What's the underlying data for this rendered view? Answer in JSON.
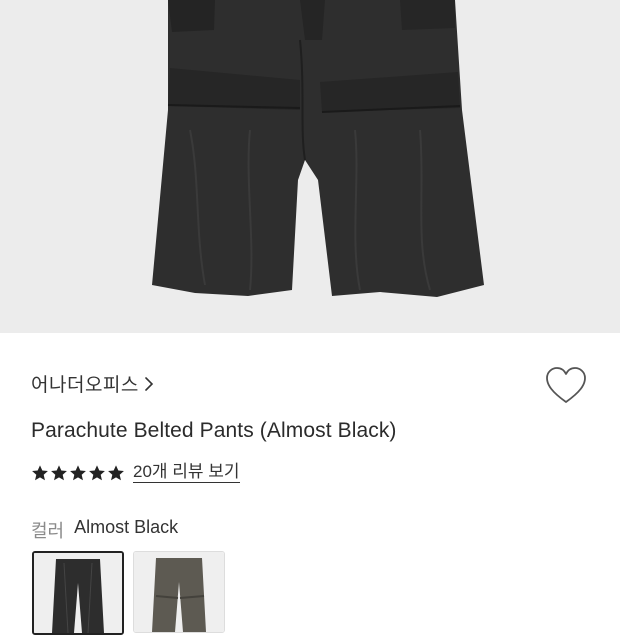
{
  "product": {
    "brand": "어나더오피스",
    "title": "Parachute Belted Pants (Almost Black)",
    "rating_stars": 5,
    "review_link": "20개 리뷰 보기",
    "color_label": "컬러",
    "color_value": "Almost Black"
  },
  "icons": {
    "brand_arrow": "chevron-right-icon",
    "wishlist": "heart-outline-icon",
    "rating": "star-icon"
  },
  "colors": {
    "hero_bg": "#ececec",
    "pants_dark": "#2f2f2f",
    "star": "#222222",
    "swatch_olive": "#5d5a52"
  }
}
